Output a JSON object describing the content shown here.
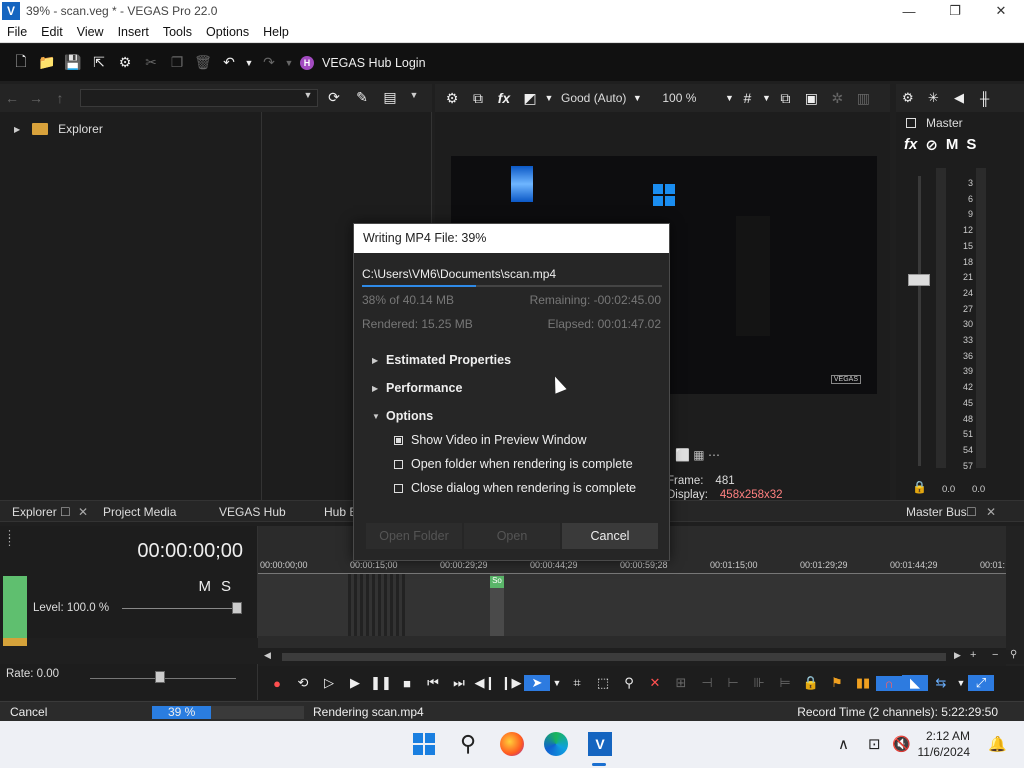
{
  "window": {
    "title": "39% - scan.veg * - VEGAS Pro 22.0",
    "app_letter": "V",
    "minimize": "—",
    "maximize": "❐",
    "close": "✕"
  },
  "menu": [
    "File",
    "Edit",
    "View",
    "Insert",
    "Tools",
    "Options",
    "Help"
  ],
  "toolbar": {
    "hub_badge": "H",
    "hub_login": "VEGAS Hub Login"
  },
  "explorer": {
    "tree_root": "Explorer"
  },
  "preview": {
    "quality": "Good (Auto)",
    "zoom": "100 %",
    "frame_label": "Frame:",
    "frame_value": "481",
    "display_label": "Display:",
    "display_value": "458x258x32",
    "vegas_tag": "VEGAS"
  },
  "mixer": {
    "master_label": "Master",
    "fx": "fx",
    "m": "M",
    "s": "S",
    "scale": [
      "3",
      "6",
      "9",
      "12",
      "15",
      "18",
      "21",
      "24",
      "27",
      "30",
      "33",
      "36",
      "39",
      "42",
      "45",
      "48",
      "51",
      "54",
      "57"
    ],
    "peak_left": "0.0",
    "peak_right": "0.0"
  },
  "tabs": {
    "explorer": "Explorer",
    "project_media": "Project Media",
    "vegas_hub": "VEGAS Hub",
    "hub_e": "Hub E",
    "master_bus": "Master Bus"
  },
  "timeline": {
    "timecode": "00:00:00;00",
    "mute": "M",
    "solo": "S",
    "level": "Level: 100.0 %",
    "rate": "Rate: 0.00",
    "ticks": [
      "00:00:00;00",
      "00:00:15;00",
      "00:00:29;29",
      "00:00:44;29",
      "00:00:59;28",
      "00:01:15;00",
      "00:01:29;29",
      "00:01:44;29",
      "00:01:"
    ],
    "clip_label": "So"
  },
  "status": {
    "cancel": "Cancel",
    "progress_percent": 39,
    "percent_text": "39 %",
    "message": "Rendering scan.mp4",
    "record_time": "Record Time (2 channels): 5:22:29:50"
  },
  "dialog": {
    "title": "Writing MP4 File: 39%",
    "path": "C:\\Users\\VM6\\Documents\\scan.mp4",
    "progress_percent": 38,
    "progress_size": "38% of 40.14 MB",
    "remaining": "Remaining: -00:02:45.00",
    "rendered": "Rendered: 15.25 MB",
    "elapsed": "Elapsed: 00:01:47.02",
    "sections": [
      "Estimated Properties",
      "Performance",
      "Options"
    ],
    "options": [
      {
        "label": "Show Video in Preview Window",
        "checked": true
      },
      {
        "label": "Open folder when rendering is complete",
        "checked": false
      },
      {
        "label": "Close dialog when rendering is complete",
        "checked": false
      }
    ],
    "open_folder": "Open Folder",
    "open": "Open",
    "cancel": "Cancel"
  },
  "taskbar": {
    "time": "2:12 AM",
    "date": "11/6/2024",
    "vegas_letter": "V"
  },
  "colors": {
    "accent_blue": "#2a7de0",
    "track_green": "#5fbf6f",
    "hub_purple": "#a24bc0",
    "record_red": "#ff4f4f"
  }
}
